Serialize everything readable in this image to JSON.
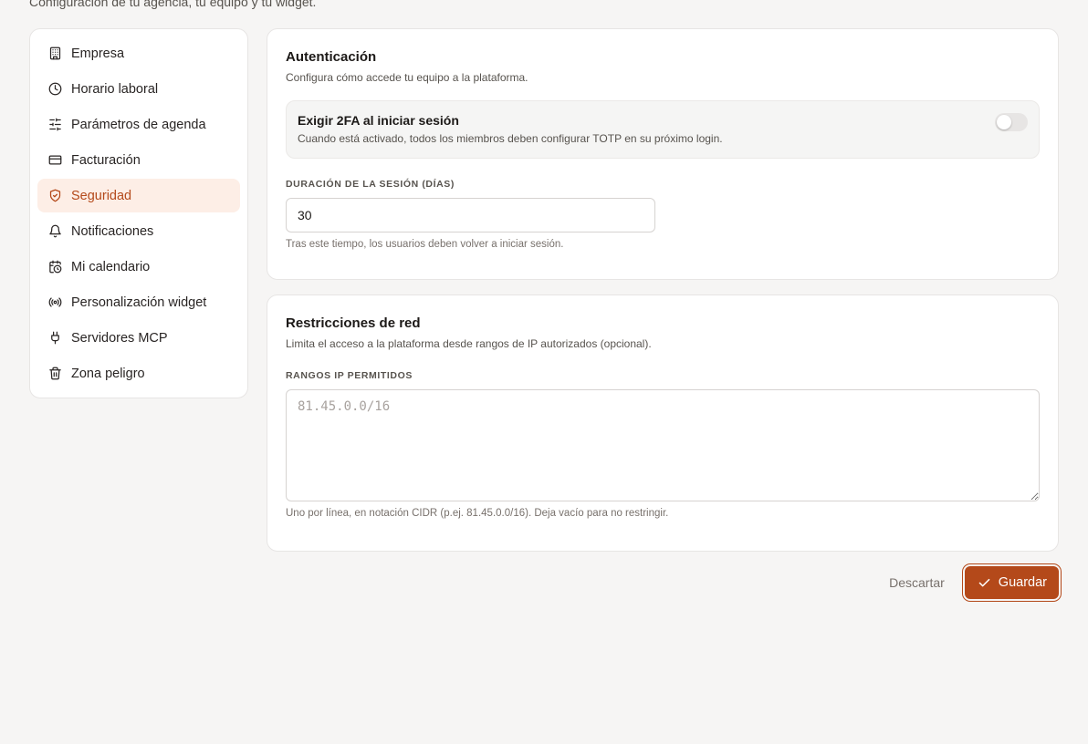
{
  "page": {
    "subtitle": "Configuración de tu agencia, tu equipo y tu widget."
  },
  "sidebar": {
    "items": [
      {
        "label": "Empresa",
        "icon": "building-icon",
        "active": false
      },
      {
        "label": "Horario laboral",
        "icon": "clock-icon",
        "active": false
      },
      {
        "label": "Parámetros de agenda",
        "icon": "sliders-icon",
        "active": false
      },
      {
        "label": "Facturación",
        "icon": "credit-card-icon",
        "active": false
      },
      {
        "label": "Seguridad",
        "icon": "shield-check-icon",
        "active": true
      },
      {
        "label": "Notificaciones",
        "icon": "bell-icon",
        "active": false
      },
      {
        "label": "Mi calendario",
        "icon": "calendar-clock-icon",
        "active": false
      },
      {
        "label": "Personalización widget",
        "icon": "radio-icon",
        "active": false
      },
      {
        "label": "Servidores MCP",
        "icon": "plug-icon",
        "active": false
      },
      {
        "label": "Zona peligro",
        "icon": "trash-icon",
        "active": false
      }
    ]
  },
  "auth": {
    "title": "Autenticación",
    "description": "Configura cómo accede tu equipo a la plataforma.",
    "twofa": {
      "title": "Exigir 2FA al iniciar sesión",
      "description": "Cuando está activado, todos los miembros deben configurar TOTP en su próximo login.",
      "enabled": false
    },
    "session": {
      "label": "Duración de la sesión (días)",
      "value": "30",
      "hint": "Tras este tiempo, los usuarios deben volver a iniciar sesión."
    }
  },
  "network": {
    "title": "Restricciones de red",
    "description": "Limita el acceso a la plataforma desde rangos de IP autorizados (opcional).",
    "ip_ranges": {
      "label": "Rangos IP permitidos",
      "placeholder": "81.45.0.0/16",
      "value": "",
      "hint": "Uno por línea, en notación CIDR (p.ej. 81.45.0.0/16). Deja vacío para no restringir."
    }
  },
  "actions": {
    "discard_label": "Descartar",
    "save_label": "Guardar"
  },
  "colors": {
    "accent": "#b4491a",
    "active_bg": "#fdeee6",
    "background": "#f6f5f4"
  }
}
